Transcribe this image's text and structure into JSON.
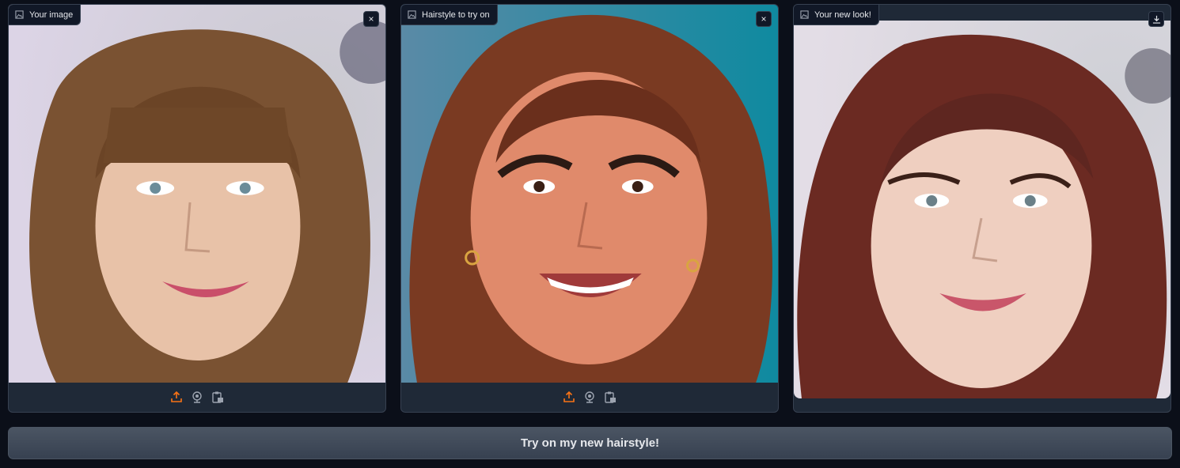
{
  "panels": [
    {
      "label": "Your image",
      "icon": "image-icon",
      "close_symbol": "×"
    },
    {
      "label": "Hairstyle to try on",
      "icon": "image-icon",
      "close_symbol": "×"
    },
    {
      "label": "Your new look!",
      "icon": "image-icon",
      "download_icon": "download-icon"
    }
  ],
  "toolbar_icons": [
    "upload-icon",
    "webcam-icon",
    "clipboard-icon"
  ],
  "submit_label": "Try on my new hairstyle!",
  "colors": {
    "background": "#0b0f19",
    "panel": "#1f2937",
    "border": "#374151",
    "accent": "#f97316",
    "button_top": "#4b5563",
    "button_bottom": "#374151"
  }
}
